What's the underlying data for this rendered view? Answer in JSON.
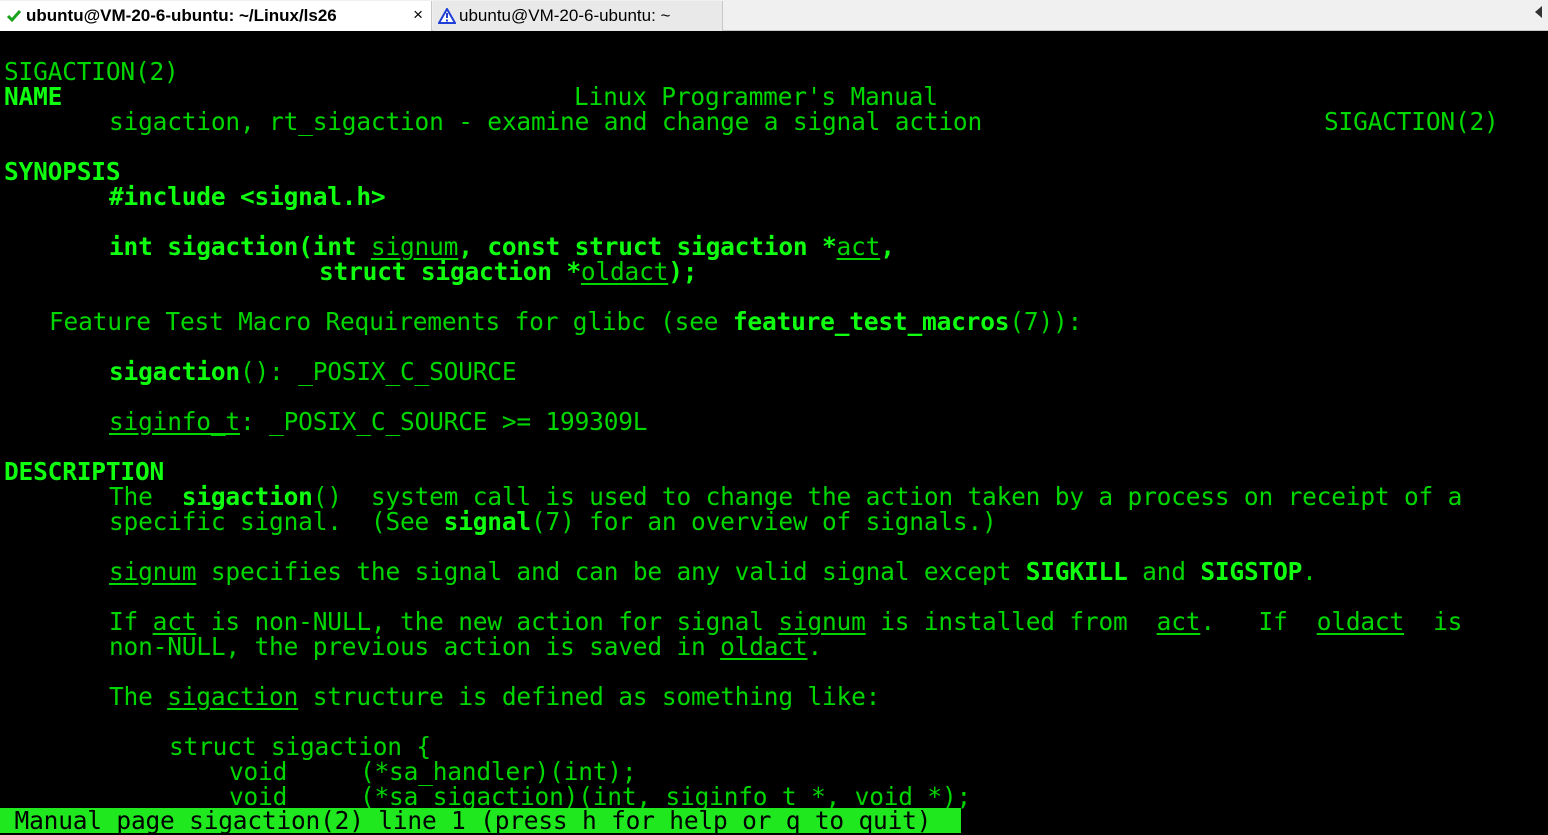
{
  "tabs": [
    {
      "label": "ubuntu@VM-20-6-ubuntu: ~/Linux/ls26",
      "status_icon": "check-icon",
      "status_color": "#1aa31a",
      "active": true,
      "close": "×"
    },
    {
      "label": "ubuntu@VM-20-6-ubuntu: ~",
      "status_icon": "warning-icon",
      "status_color": "#1f3fd6",
      "active": false
    }
  ],
  "colors": {
    "background": "#000000",
    "text": "#00d600",
    "bold": "#10ff10",
    "status_bg": "#1fe81f"
  },
  "man": {
    "header_left": "SIGACTION(2)",
    "header_center": "Linux Programmer's Manual",
    "header_right": "SIGACTION(2)",
    "name_heading": "NAME",
    "name_text": "sigaction, rt_sigaction - examine and change a signal action",
    "synopsis_heading": "SYNOPSIS",
    "include": "#include <signal.h>",
    "proto1_a": "int sigaction(int ",
    "proto1_signum": "signum",
    "proto1_b": ", const struct sigaction *",
    "proto1_act": "act",
    "proto1_c": ",",
    "proto2_a": "struct sigaction *",
    "proto2_oldact": "oldact",
    "proto2_b": ");",
    "ftm_a": "Feature Test Macro Requirements for glibc (see ",
    "ftm_link": "feature_test_macros",
    "ftm_b": "(7)):",
    "ftm1_name": "sigaction",
    "ftm1_rest": "(): _POSIX_C_SOURCE",
    "ftm2_name": "siginfo_t",
    "ftm2_rest": ": _POSIX_C_SOURCE >= 199309L",
    "description_heading": "DESCRIPTION",
    "d1_a": "The  ",
    "d1_b": "sigaction",
    "d1_c": "()  system call is used to change the action taken by a process on receipt of a",
    "d2_a": "specific signal.  (See ",
    "d2_b": "signal",
    "d2_c": "(7) for an overview of signals.)",
    "d3_a": "signum",
    "d3_b": " specifies the signal and can be any valid signal except ",
    "d3_c": "SIGKILL",
    "d3_d": " and ",
    "d3_e": "SIGSTOP",
    "d3_f": ".",
    "d4_a": "If ",
    "d4_b": "act",
    "d4_c": " is non-NULL, the new action for signal ",
    "d4_d": "signum",
    "d4_e": " is installed from  ",
    "d4_f": "act",
    "d4_g": ".   If  ",
    "d4_h": "oldact",
    "d4_i": "  is",
    "d5_a": "non-NULL, the previous action is saved in ",
    "d5_b": "oldact",
    "d5_c": ".",
    "d6_a": "The ",
    "d6_b": "sigaction",
    "d6_c": " structure is defined as something like:",
    "s1": "struct sigaction {",
    "s2": "void     (*sa_handler)(int);",
    "s3": "void     (*sa_sigaction)(int, siginfo_t *, void *);"
  },
  "status_line": " Manual page sigaction(2) line 1 (press h for help or q to quit)"
}
